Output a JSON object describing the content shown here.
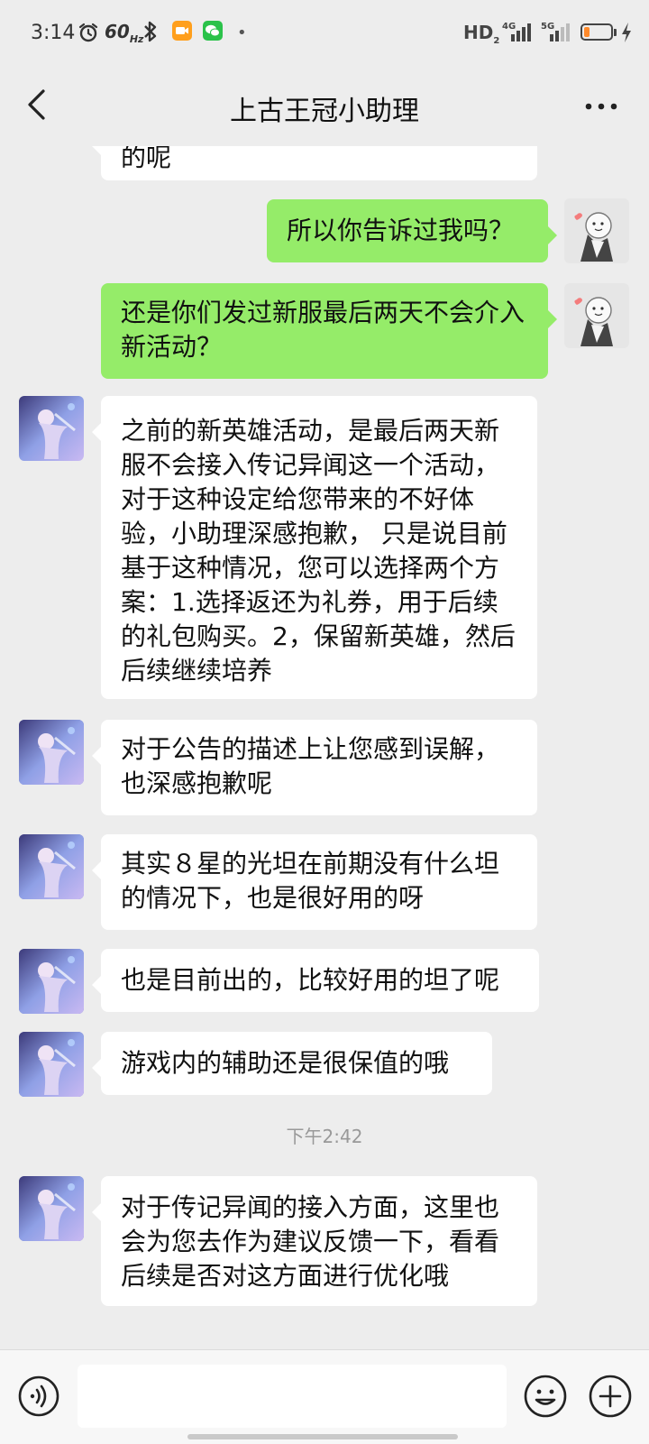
{
  "status_bar": {
    "time": "3:14",
    "refresh_rate": "60",
    "refresh_unit": "Hz",
    "hd_label": "HD",
    "hd_sub": "2",
    "net1": "4G",
    "net2": "5G",
    "battery_percent": 20,
    "colors": {
      "battery": "#ff8a2b",
      "recorder": "#ff9f1c",
      "wechat": "#2bc24a"
    }
  },
  "header": {
    "title": "上古王冠小助理"
  },
  "messages": [
    {
      "side": "in",
      "text": "的呢"
    },
    {
      "side": "out",
      "text": "所以你告诉过我吗？"
    },
    {
      "side": "out",
      "text": "还是你们发过新服最后两天不会介入新活动？"
    },
    {
      "side": "in",
      "text": "之前的新英雄活动，是最后两天新服不会接入传记异闻这一个活动，对于这种设定给您带来的不好体验，小助理深感抱歉， 只是说目前基于这种情况，您可以选择两个方案：1.选择返还为礼券，用于后续的礼包购买。2，保留新英雄，然后后续继续培养"
    },
    {
      "side": "in",
      "text": "对于公告的描述上让您感到误解，也深感抱歉呢"
    },
    {
      "side": "in",
      "text": "其实８星的光坦在前期没有什么坦的情况下，也是很好用的呀"
    },
    {
      "side": "in",
      "text": "也是目前出的，比较好用的坦了呢"
    },
    {
      "side": "in",
      "text": "游戏内的辅助还是很保值的哦"
    },
    {
      "side": "in",
      "text": "对于传记异闻的接入方面，这里也会为您去作为建议反馈一下，看看后续是否对这方面进行优化哦"
    }
  ],
  "timestamp": "下午2:42",
  "input": {
    "placeholder": ""
  },
  "colors": {
    "background": "#ededed",
    "bubble_out": "#95ec69",
    "bubble_in": "#ffffff"
  }
}
